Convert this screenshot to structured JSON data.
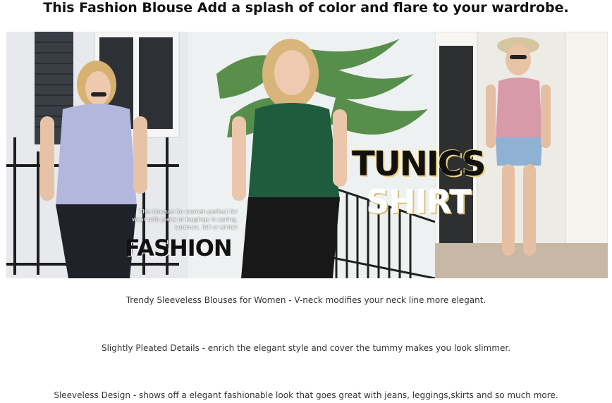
{
  "title": "This Fashion Blouse Add a splash of color and flare to your wardrobe.",
  "banner": {
    "blurb": "This blouses for women perfect for wear with jeans or leggings in spring, summer, fall or winter",
    "fashion_text": "FASHION",
    "tunics_text": "TUNICS",
    "shirt_text": "SHIRT"
  },
  "features": [
    "Trendy Sleeveless Blouses for Women - V-neck modifies your neck line more elegant.",
    "Slightly Pleated Details - enrich the elegant style and cover the tummy makes you look slimmer.",
    "Sleeveless Design - shows off a elegant fashionable look that goes great with jeans, leggings,skirts and so much more."
  ]
}
